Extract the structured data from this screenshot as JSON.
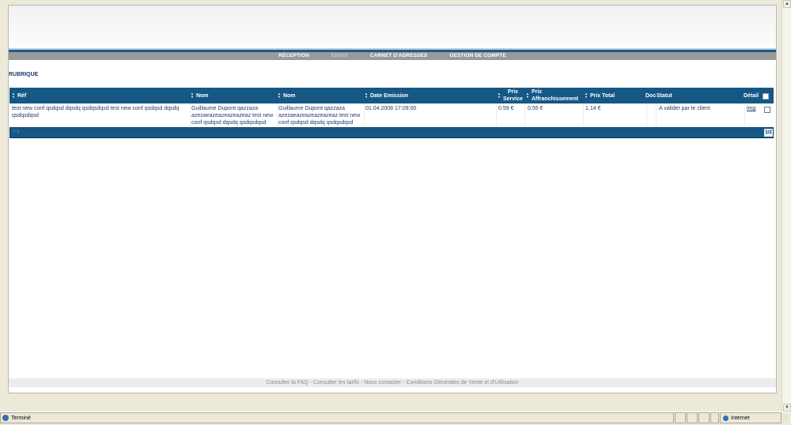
{
  "nav": {
    "reception": "RÉCEPTION",
    "envoi": "ENVOI",
    "carnet": "CARNET D'ADRESSES",
    "gestion": "GESTION DE COMPTE"
  },
  "rubrique": "RUBRIQUE",
  "table": {
    "headers": {
      "ref": "Réf",
      "nom1": "Nom",
      "nom2": "Nom",
      "date": "Date Emission",
      "prix_service_1": "Prix",
      "prix_service_2": "Service",
      "prix_aff_1": "Prix",
      "prix_aff_2": "Affranchissement",
      "prix_total": "Prix Total",
      "doc": "Doc",
      "statut": "Statut",
      "detail": "Détail"
    },
    "row": {
      "ref": "test new conf qsdqsd dqsdq qsdqsdqsd test new conf qsdqsd dqsdq qsdqsdqsd",
      "nom1": "Guillaume Dupont qazzaza azezaeazeazeazeazeaz test new conf qsdqsd dqsdq qsdqsdqsd",
      "nom2": "Guillaume Dupont qazzaza azezaeazeazeazeazeaz test new conf qsdqsd dqsdq qsdqsdqsd",
      "date": "01.04.2008 17:09:00",
      "prix_service": "0.59 €",
      "prix_aff": "0.55 €",
      "prix_total": "1.14 €",
      "statut": "A valider par le client",
      "detail_link": "img"
    },
    "pager": {
      "left": "< 1",
      "page": "1/2"
    }
  },
  "footer": {
    "faq": "Consulter la FAQ",
    "tarifs": "Consulter les tarifs",
    "contact": "Nous contacter",
    "cgv": "Conditions Générales de Vente et d'Utilisation",
    "sep": " - "
  },
  "statusbar": {
    "left": "Terminé",
    "zone": "Internet"
  }
}
